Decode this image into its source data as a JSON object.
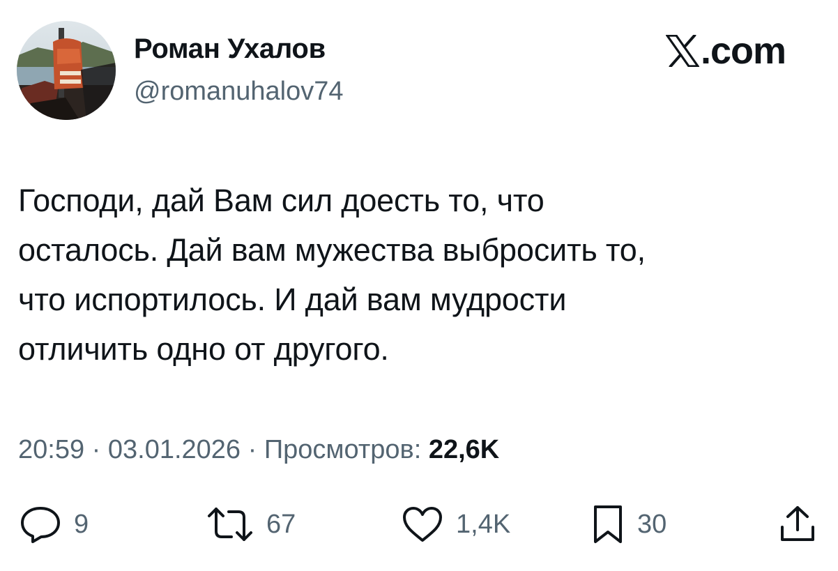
{
  "author": {
    "display_name": "Роман Ухалов",
    "handle": "@romanuhalov74"
  },
  "brand": {
    "domain": ".com",
    "logo_icon": "x-logo-icon"
  },
  "tweet": {
    "lines": [
      "Господи, дай Вам сил доесть то, что",
      "осталось. Дай вам мужества выбросить то,",
      "что испортилось. И дай вам мудрости",
      "отличить одно от другого."
    ]
  },
  "meta": {
    "time": "20:59",
    "separator": " · ",
    "date": "03.01.2026",
    "views_label": "Просмотров:",
    "views_count": "22,6K"
  },
  "actions": {
    "replies": {
      "icon": "reply-icon",
      "count": "9"
    },
    "retweets": {
      "icon": "retweet-icon",
      "count": "67"
    },
    "likes": {
      "icon": "heart-icon",
      "count": "1,4K"
    },
    "bookmarks": {
      "icon": "bookmark-icon",
      "count": "30"
    },
    "share": {
      "icon": "share-icon"
    }
  },
  "colors": {
    "text_primary": "#0f1419",
    "text_secondary": "#536471",
    "background": "#ffffff"
  }
}
